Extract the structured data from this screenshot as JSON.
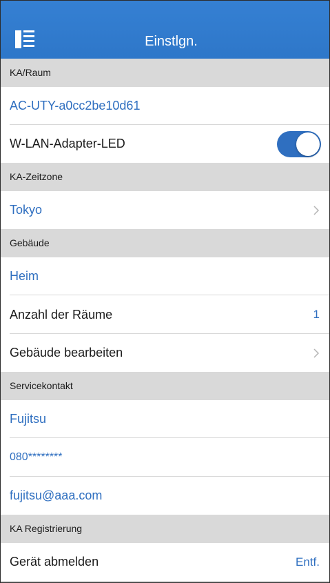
{
  "header": {
    "title": "Einstlgn.",
    "menu_icon": "sidebar-menu-icon",
    "background_color": "#2f7bd0"
  },
  "sections": {
    "ka_raum": {
      "header": "KA/Raum",
      "device_name": "AC-UTY-a0cc2be10d61",
      "led_label": "W-LAN-Adapter-LED",
      "led_enabled": true
    },
    "zeitzone": {
      "header": "KA-Zeitzone",
      "value": "Tokyo"
    },
    "gebaeude": {
      "header": "Gebäude",
      "name": "Heim",
      "rooms_label": "Anzahl der Räume",
      "rooms_value": "1",
      "edit_label": "Gebäude bearbeiten"
    },
    "service": {
      "header": "Servicekontakt",
      "company": "Fujitsu",
      "phone": "080********",
      "email": "fujitsu@aaa.com"
    },
    "registrierung": {
      "header": "KA Registrierung",
      "unregister_label": "Gerät abmelden",
      "unregister_action": "Entf."
    }
  },
  "colors": {
    "accent_blue": "#2f6fc0",
    "section_bg": "#d9d9d9"
  }
}
